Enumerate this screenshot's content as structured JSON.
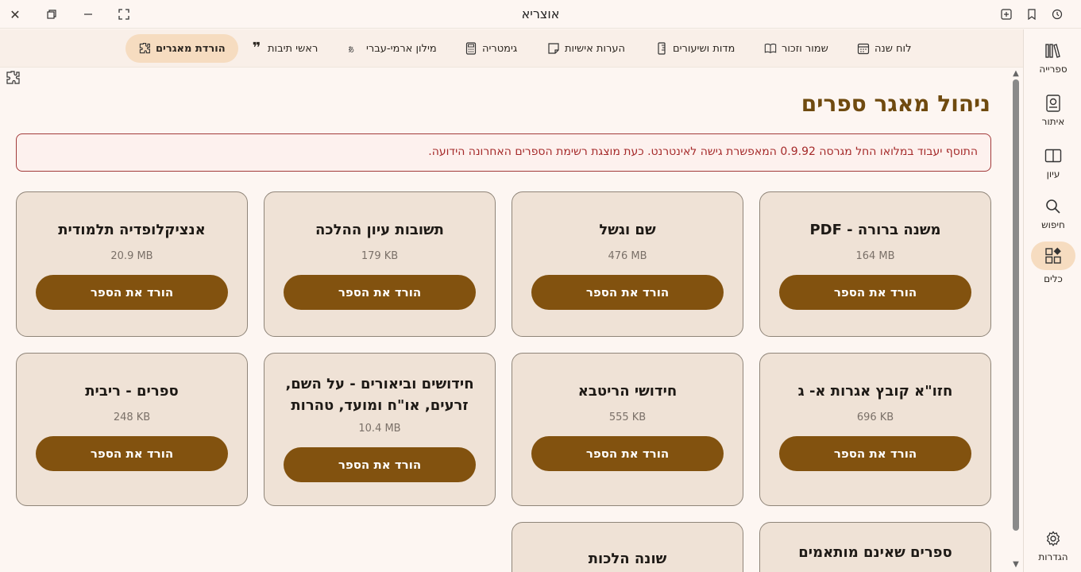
{
  "window": {
    "title": "אוצריא"
  },
  "toolbar": {
    "items": [
      {
        "label": "לוח שנה",
        "icon": "calendar-icon"
      },
      {
        "label": "שמור וזכור",
        "icon": "book-open-icon"
      },
      {
        "label": "מדות ושיעורים",
        "icon": "ruler-icon"
      },
      {
        "label": "הערות אישיות",
        "icon": "note-icon"
      },
      {
        "label": "גימטריה",
        "icon": "calculator-icon"
      },
      {
        "label": "מילון ארמי-עברי",
        "icon": "translate-icon"
      },
      {
        "label": "ראשי תיבות",
        "icon": "quote-icon"
      },
      {
        "label": "הורדת מאגרים",
        "icon": "puzzle-icon",
        "active": true
      }
    ]
  },
  "sidebar": {
    "items": [
      {
        "label": "ספרייה",
        "icon": "library-icon"
      },
      {
        "label": "איתור",
        "icon": "locate-book-icon"
      },
      {
        "label": "עיון",
        "icon": "book-icon"
      },
      {
        "label": "חיפוש",
        "icon": "search-icon"
      },
      {
        "label": "כלים",
        "icon": "tools-icon",
        "active": true
      },
      {
        "label": "הגדרות",
        "icon": "gear-icon"
      }
    ]
  },
  "main": {
    "title": "ניהול מאגר ספרים",
    "notice": "התוסף יעבוד במלואו החל מגרסה 0.9.92 המאפשרת גישה לאינטרנט. כעת מוצגת רשימת הספרים האחרונה הידועה.",
    "download_label": "הורד את הספר",
    "books": [
      {
        "title": "משנה ברורה - PDF",
        "size": "164 MB"
      },
      {
        "title": "שם וגשל",
        "size": "476 MB"
      },
      {
        "title": "תשובות עיון ההלכה",
        "size": "179 KB"
      },
      {
        "title": "אנציקלופדיה תלמודית",
        "size": "20.9 MB"
      },
      {
        "title": "חזו\"א קובץ אגרות א- ג",
        "size": "696 KB"
      },
      {
        "title": "חידושי הריטבא",
        "size": "555 KB"
      },
      {
        "title": "חידושים וביאורים - על השם, זרעים, או\"ח ומועד, טהרות",
        "size": "10.4 MB"
      },
      {
        "title": "ספרים - ריבית",
        "size": "248 KB"
      },
      {
        "title": "ספרים שאינם מותאמים",
        "size": ""
      },
      {
        "title": "שונה הלכות",
        "size": ""
      }
    ]
  },
  "colors": {
    "accent": "#82520f",
    "title": "#6f4a0f",
    "active_bg": "#f6dcc0",
    "card_bg": "#efe2d6",
    "notice_border": "#a23a3a"
  }
}
